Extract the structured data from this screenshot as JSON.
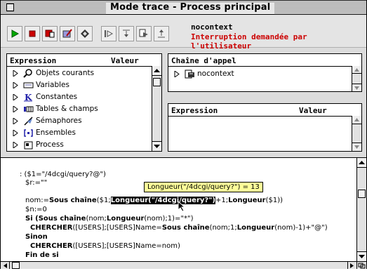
{
  "window": {
    "title": "Mode trace - Process principal"
  },
  "toolbar": {
    "buttons": [
      {
        "icon": "play-icon",
        "color": "#00aa00"
      },
      {
        "icon": "stop-icon",
        "color": "#cc0000"
      },
      {
        "icon": "abort-icon",
        "color": "#cc0000"
      },
      {
        "icon": "edit-icon",
        "color": "#6666cc"
      },
      {
        "icon": "tool-icon",
        "color": "#333333"
      },
      {
        "icon": "step-over-icon",
        "color": "#555555"
      },
      {
        "icon": "step-into-icon",
        "color": "#555555"
      },
      {
        "icon": "step-routine-icon",
        "color": "#555555"
      },
      {
        "icon": "step-out-icon",
        "color": "#555555"
      }
    ],
    "routine_name": "nocontext",
    "status_message": "Interruption demandée par l'utilisateur"
  },
  "expression_pane": {
    "header_expression": "Expression",
    "header_value": "Valeur",
    "items": [
      {
        "label": "Objets courants",
        "icon": "magnifier-icon"
      },
      {
        "label": "Variables",
        "icon": "variables-icon"
      },
      {
        "label": "Constantes",
        "icon": "constants-icon"
      },
      {
        "label": "Tables & champs",
        "icon": "tables-icon"
      },
      {
        "label": "Sémaphores",
        "icon": "semaphore-icon"
      },
      {
        "label": "Ensembles",
        "icon": "sets-icon"
      },
      {
        "label": "Process",
        "icon": "process-icon"
      }
    ]
  },
  "call_chain_pane": {
    "header": "Chaîne d'appel",
    "items": [
      {
        "label": "nocontext",
        "icon": "method-icon"
      }
    ]
  },
  "custom_watch_pane": {
    "header_expression": "Expression",
    "header_value": "Valeur"
  },
  "code": {
    "lines": [
      {
        "segments": [
          {
            "text": ": ($1=\"/4dcgi/query?@\")"
          }
        ]
      },
      {
        "segments": [
          {
            "text": "$r:=\"\""
          }
        ]
      },
      {
        "segments": [
          {
            "text": "nom:="
          },
          {
            "text": "Sous chaîne",
            "style": "bold"
          },
          {
            "text": "($1;"
          },
          {
            "text": "Longueur(\"/4dcgi/query?\")",
            "style": "highlight"
          },
          {
            "text": "+1;"
          },
          {
            "text": "Longueur",
            "style": "bold"
          },
          {
            "text": "($1))"
          }
        ]
      },
      {
        "segments": [
          {
            "text": "$n:=0"
          }
        ]
      },
      {
        "segments": [
          {
            "text": "Si (",
            "style": "bold"
          },
          {
            "text": "Sous chaîne",
            "style": "bold"
          },
          {
            "text": "(nom;"
          },
          {
            "text": "Longueur",
            "style": "bold"
          },
          {
            "text": "(nom);1)=\"*\")"
          }
        ]
      },
      {
        "segments": [
          {
            "text": "CHERCHER",
            "style": "bold"
          },
          {
            "text": "([USERS];[USERS]Name="
          },
          {
            "text": "Sous chaîne",
            "style": "bold"
          },
          {
            "text": "(nom;1;"
          },
          {
            "text": "Longueur",
            "style": "bold"
          },
          {
            "text": "(nom)-1)+\"@\")"
          }
        ]
      },
      {
        "segments": [
          {
            "text": "Sinon",
            "style": "bold"
          }
        ]
      },
      {
        "segments": [
          {
            "text": "CHERCHER",
            "style": "bold"
          },
          {
            "text": "([USERS];[USERS]Name=nom)"
          }
        ]
      },
      {
        "segments": [
          {
            "text": "Fin de si",
            "style": "bold"
          }
        ]
      }
    ],
    "tooltip": "Longueur(\"/4dcgi/query?\") = 13"
  }
}
